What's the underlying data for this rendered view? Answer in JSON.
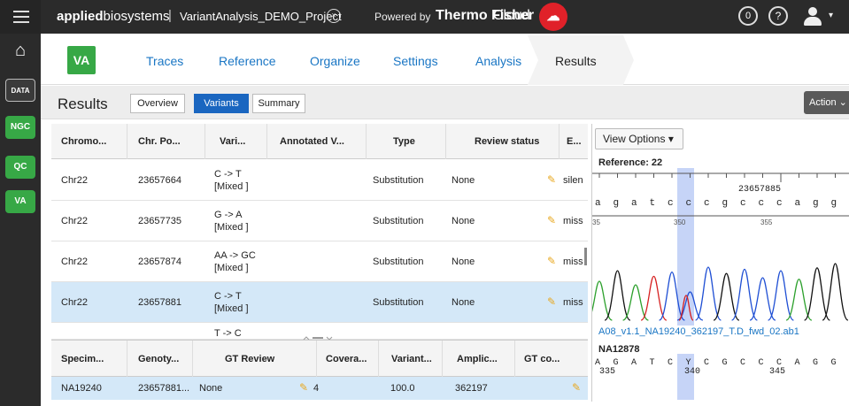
{
  "topbar": {
    "brand_bold": "applied",
    "brand_light": "biosystems",
    "separator": "|",
    "project": "VariantAnalysis_DEMO_Project",
    "powered_by": "Powered by",
    "company": "Thermo Fisher",
    "cloud": "Cloud",
    "notif_count": "0",
    "help": "?"
  },
  "sidebar": {
    "items": [
      {
        "label": "DATA"
      },
      {
        "label": "NGC"
      },
      {
        "label": "QC"
      },
      {
        "label": "VA"
      }
    ]
  },
  "nav": {
    "badge": "VA",
    "tabs": [
      {
        "label": "Traces"
      },
      {
        "label": "Reference"
      },
      {
        "label": "Organize"
      },
      {
        "label": "Settings"
      },
      {
        "label": "Analysis"
      },
      {
        "label": "Results"
      }
    ]
  },
  "subbar": {
    "title": "Results",
    "buttons": [
      {
        "label": "Overview"
      },
      {
        "label": "Variants"
      },
      {
        "label": "Summary"
      }
    ],
    "action": "Action"
  },
  "variants_table": {
    "headers": [
      "Chromo...",
      "Chr. Po...",
      "Vari...",
      "Annotated V...",
      "Type",
      "Review status",
      "E..."
    ],
    "rows": [
      {
        "chrom": "Chr22",
        "pos": "23657664",
        "variant1": "C -> T",
        "variant2": "[Mixed ]",
        "type": "Substitution",
        "review": "None",
        "effect": "silen"
      },
      {
        "chrom": "Chr22",
        "pos": "23657735",
        "variant1": "G -> A",
        "variant2": "[Mixed ]",
        "type": "Substitution",
        "review": "None",
        "effect": "miss"
      },
      {
        "chrom": "Chr22",
        "pos": "23657874",
        "variant1": "AA -> GC",
        "variant2": "[Mixed ]",
        "type": "Substitution",
        "review": "None",
        "effect": "miss"
      },
      {
        "chrom": "Chr22",
        "pos": "23657881",
        "variant1": "C -> T",
        "variant2": "[Mixed ]",
        "type": "Substitution",
        "review": "None",
        "effect": "miss"
      },
      {
        "chrom": "",
        "pos": "",
        "variant1": "T -> C",
        "variant2": "",
        "type": "",
        "review": "",
        "effect": ""
      }
    ]
  },
  "specimen_table": {
    "headers": [
      "Specim...",
      "Genoty...",
      "GT Review",
      "Covera...",
      "Variant...",
      "Amplic...",
      "GT co..."
    ],
    "row": {
      "specimen": "NA19240",
      "genotype": "23657881...",
      "gt_review": "None",
      "coverage": "4",
      "variant": "100.0",
      "amplicon": "362197",
      "gt_comment": ""
    }
  },
  "trace_panel": {
    "view_options": "View Options",
    "reference_label": "Reference: 22",
    "ref_position": "23657885",
    "ref_bases": [
      "a",
      "g",
      "a",
      "t",
      "c",
      "c",
      "c",
      "g",
      "c",
      "c",
      "c",
      "a",
      "g",
      "g"
    ],
    "ref_ticks": [
      "35",
      "350",
      "355"
    ],
    "file_name": "A08_v1.1_NA19240_362197_T.D_fwd_02.ab1",
    "sample": "NA12878",
    "sample_bases": [
      "A",
      "G",
      "A",
      "T",
      "C",
      "Y",
      "C",
      "G",
      "C",
      "C",
      "C",
      "A",
      "G",
      "G"
    ],
    "sample_ticks": [
      "335",
      "340",
      "345"
    ]
  },
  "colors": {
    "accent_blue": "#1a76c4",
    "green": "#37a846",
    "selected_row": "#d4e8f8",
    "highlight_column": "#b8c9f5",
    "trace_A": "#2ca02c",
    "trace_C": "#1f4fd4",
    "trace_G": "#111111",
    "trace_T": "#d62020"
  }
}
